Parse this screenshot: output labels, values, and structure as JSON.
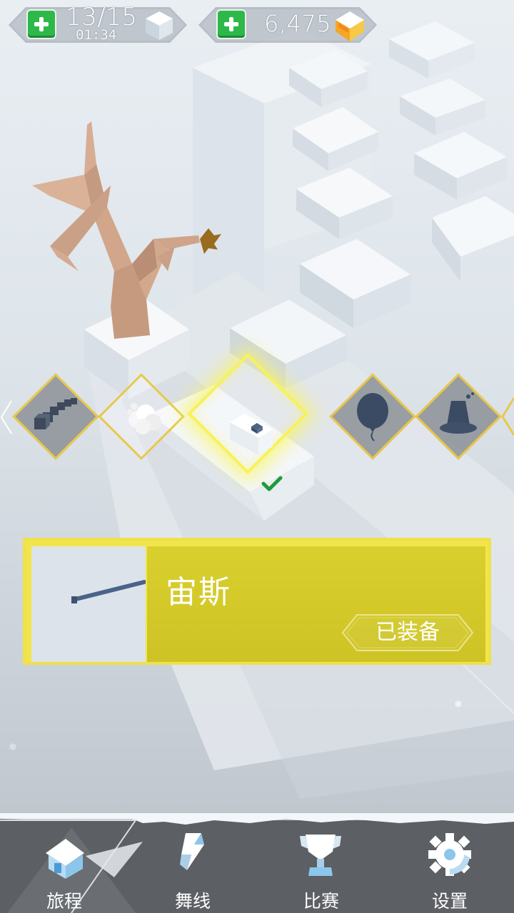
{
  "hud": {
    "energy": {
      "count": "13/15",
      "timer": "01:34",
      "add_icon": "plus-icon",
      "resource_icon": "ice-cube-icon"
    },
    "gems": {
      "count": "6,475",
      "add_icon": "plus-icon",
      "resource_icon": "gem-icon"
    }
  },
  "carousel": {
    "items": [
      {
        "name": "trail-cubes",
        "icon": "cube-trail-icon",
        "selected": false
      },
      {
        "name": "trail-cloud",
        "icon": "cloud-icon",
        "selected": false
      },
      {
        "name": "trail-stick",
        "icon": "stick-icon",
        "selected": true,
        "equipped": true
      },
      {
        "name": "trail-balloon",
        "icon": "balloon-icon",
        "selected": false
      },
      {
        "name": "trail-bucket",
        "icon": "bucket-icon",
        "selected": false
      }
    ]
  },
  "item_card": {
    "name": "宙斯",
    "status": "已装备"
  },
  "nav": {
    "items": [
      {
        "label": "旅程",
        "icon": "house-icon",
        "active": true
      },
      {
        "label": "舞线",
        "icon": "dance-line-icon",
        "active": false
      },
      {
        "label": "比赛",
        "icon": "trophy-icon",
        "active": false
      },
      {
        "label": "设置",
        "icon": "gear-icon",
        "active": false
      }
    ]
  },
  "colors": {
    "accent_yellow": "#f2e54c",
    "card_yellow": "#d6cc2b",
    "plus_green": "#2fb84a",
    "nav_bg": "#5f6266",
    "check_green": "#1e9a3e"
  }
}
